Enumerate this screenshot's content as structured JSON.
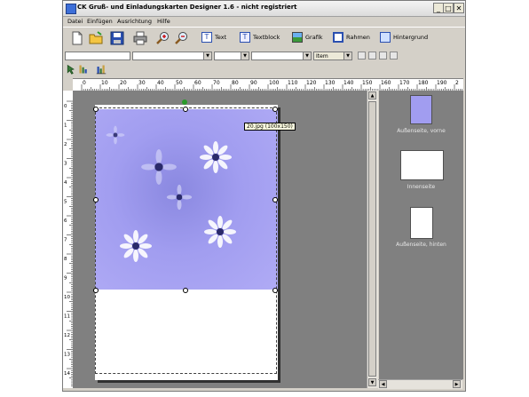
{
  "window": {
    "title": "CK Gruß- und Einladungskarten Designer 1.6 - nicht registriert",
    "controls": {
      "minimize": "_",
      "maximize": "□",
      "close": "✕"
    }
  },
  "menu": [
    "Datei",
    "Einfügen",
    "Ausrichtung",
    "Hilfe"
  ],
  "toolbar": {
    "text_label": "Text",
    "textblock_label": "Textblock",
    "grafik_label": "Grafik",
    "rahmen_label": "Rahmen",
    "hintergrund_label": "Hintergrund"
  },
  "format_bar": {
    "font_value": "",
    "size_value": "",
    "unit_value": "Item"
  },
  "ruler": {
    "h_labels": [
      "0",
      "10",
      "20",
      "30",
      "40",
      "50",
      "60",
      "70",
      "80",
      "90",
      "100",
      "110",
      "120",
      "130",
      "140",
      "150",
      "160",
      "170",
      "180",
      "190",
      "2"
    ],
    "v_labels": [
      "0",
      "1",
      "2",
      "3",
      "4",
      "5",
      "6",
      "7",
      "8",
      "9",
      "10",
      "11",
      "12",
      "13",
      "14"
    ]
  },
  "canvas": {
    "tooltip": "20.jpg (100x150)"
  },
  "side_panel": {
    "items": [
      "Außenseite, vorne",
      "Innenseite",
      "Außenseite, hinten"
    ]
  },
  "colors": {
    "canvas_bg": "#808080",
    "picture_bg": "#a19df0",
    "chrome": "#d4d0c8"
  }
}
